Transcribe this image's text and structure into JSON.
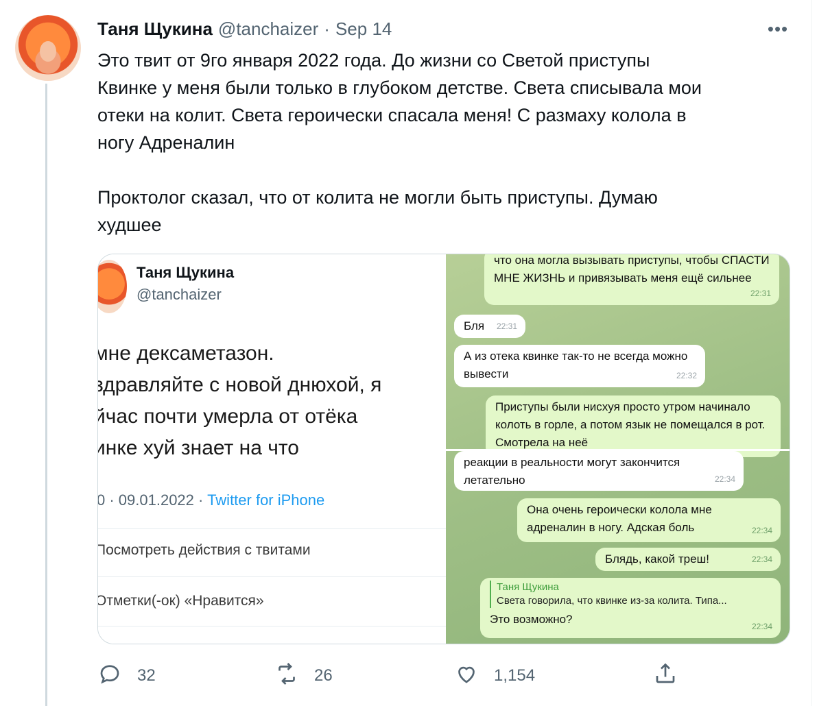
{
  "tweet": {
    "author_name": "Таня Щукина",
    "handle": "@tanchaizer",
    "separator": "·",
    "date": "Sep 14",
    "text_paragraphs": [
      [
        "Это твит от 9го января 2022 года. До жизни со Светой приступы",
        "Квинке у меня были только в глубоком детстве. Света списывала мои",
        "отеки на колит. Света героически спасала меня! С размаху колола в",
        "ногу Адреналин"
      ],
      [
        "Проктолог сказал, что от колита не могли быть приступы. Думаю",
        "худшее"
      ]
    ],
    "more_icon": "more-icon"
  },
  "media_left": {
    "name": "Таня Щукина",
    "handle": "@tanchaizer",
    "text_lines": [
      "мне дексаметазон.",
      "здравляйте с новой днюхой, я",
      "йчас почти умерла от отёка",
      "инке хуй знает на что"
    ],
    "meta_time": "0 · 09.01.2022 ·",
    "meta_source": "Twitter for iPhone",
    "action_1": "Посмотреть действия с твитами",
    "action_2": "Отметки(-ок) «Нравится»"
  },
  "media_right": {
    "messages": [
      {
        "dir": "out",
        "text": "что она могла вызывать приступы, чтобы СПАСТИ МНЕ ЖИЗНЬ и привязывать меня ещё сильнее",
        "time": "22:31"
      },
      {
        "dir": "in",
        "text": "Бля",
        "time": "22:31"
      },
      {
        "dir": "in",
        "text": "А из отека квинке так-то не всегда можно вывести",
        "time": "22:32"
      },
      {
        "dir": "out",
        "text": "Приступы были нисхуя просто утром начинало колоть в горле, а потом язык не помещался в рот. Смотрела на неё",
        "time": ""
      },
      {
        "dir": "in",
        "text": "реакции в реальности могут закончится летательно",
        "time": "22:34"
      },
      {
        "dir": "out",
        "text": "Она очень героически колола мне адреналин в ногу. Адская боль",
        "time": "22:34"
      },
      {
        "dir": "out",
        "text": "Блядь, какой треш!",
        "time": "22:34"
      },
      {
        "dir": "out",
        "reply_name": "Таня Щукина",
        "reply_text": "Света говорила, что квинке из-за колита. Типа...",
        "text": "Это возможно?",
        "time": "22:34"
      }
    ]
  },
  "actions": {
    "reply_count": "32",
    "retweet_count": "26",
    "like_count": "1,154"
  }
}
